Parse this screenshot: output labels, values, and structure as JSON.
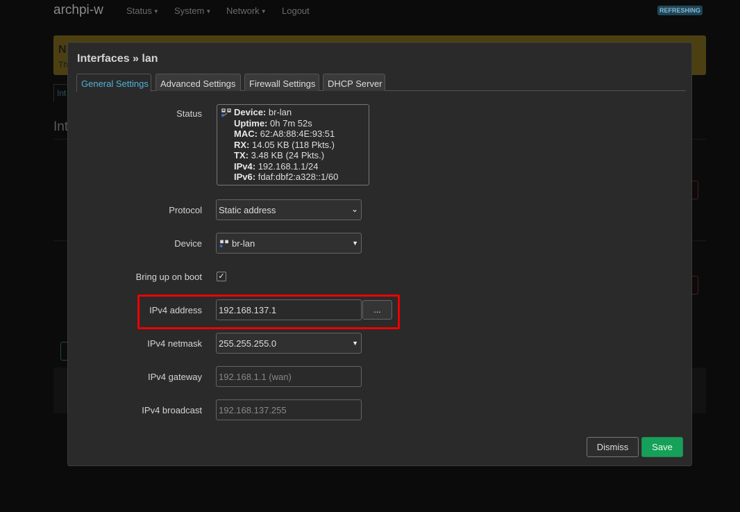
{
  "header": {
    "brand": "archpi-w",
    "nav": [
      "Status",
      "System",
      "Network",
      "Logout"
    ],
    "badge": "REFRESHING"
  },
  "background": {
    "notice_title": "N",
    "notice_text": "Th",
    "tab_partial": "Int",
    "heading_partial": "Int"
  },
  "modal": {
    "title": "Interfaces » lan",
    "tabs": [
      "General Settings",
      "Advanced Settings",
      "Firewall Settings",
      "DHCP Server"
    ],
    "active_tab": "General Settings",
    "status": {
      "label": "Status",
      "lines": [
        {
          "key": "Device:",
          "value": "br-lan"
        },
        {
          "key": "Uptime:",
          "value": "0h 7m 52s"
        },
        {
          "key": "MAC:",
          "value": "62:A8:88:4E:93:51"
        },
        {
          "key": "RX:",
          "value": "14.05 KB (118 Pkts.)"
        },
        {
          "key": "TX:",
          "value": "3.48 KB (24 Pkts.)"
        },
        {
          "key": "IPv4:",
          "value": "192.168.1.1/24"
        },
        {
          "key": "IPv6:",
          "value": "fdaf:dbf2:a328::1/60"
        }
      ]
    },
    "protocol": {
      "label": "Protocol",
      "value": "Static address"
    },
    "device": {
      "label": "Device",
      "value": "br-lan"
    },
    "boot": {
      "label": "Bring up on boot",
      "checked": true,
      "mark": "✓"
    },
    "ipv4_address": {
      "label": "IPv4 address",
      "value": "192.168.137.1",
      "extra_button": "..."
    },
    "ipv4_netmask": {
      "label": "IPv4 netmask",
      "value": "255.255.255.0"
    },
    "ipv4_gateway": {
      "label": "IPv4 gateway",
      "placeholder": "192.168.1.1 (wan)"
    },
    "ipv4_broadcast": {
      "label": "IPv4 broadcast",
      "placeholder": "192.168.137.255"
    },
    "buttons": {
      "dismiss": "Dismiss",
      "save": "Save"
    }
  },
  "colors": {
    "accent": "#4fb3d9",
    "save": "#16a05a",
    "highlight": "#e00000"
  }
}
